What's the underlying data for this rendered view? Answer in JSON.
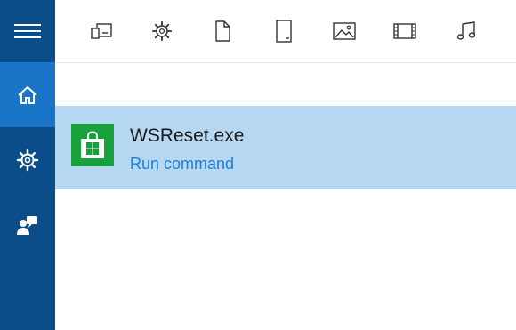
{
  "sidebar": {
    "items": [
      {
        "name": "menu",
        "icon": "hamburger-menu-icon"
      },
      {
        "name": "home",
        "icon": "home-icon",
        "selected": true
      },
      {
        "name": "settings",
        "icon": "gear-icon"
      },
      {
        "name": "feedback",
        "icon": "feedback-icon"
      }
    ]
  },
  "filters": {
    "icons": [
      "apps-icon",
      "settings-icon",
      "documents-icon",
      "folders-icon",
      "photos-icon",
      "videos-icon",
      "music-icon"
    ]
  },
  "result": {
    "title": "WSReset.exe",
    "action": "Run command",
    "icon": "store-bag-icon"
  },
  "colors": {
    "sidebar": "#0b4d88",
    "sidebar_selected": "#1a75c9",
    "result_highlight": "#b6d8f2",
    "tile": "#16a13a",
    "link": "#1f7fd6"
  }
}
